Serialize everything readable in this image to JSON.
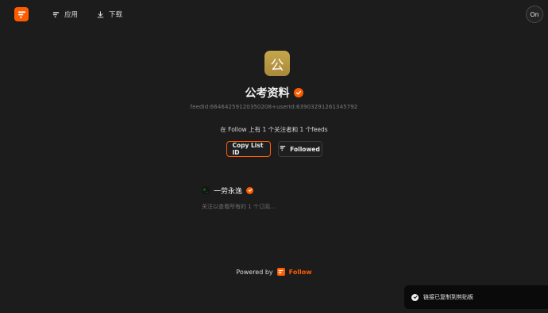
{
  "header": {
    "nav": [
      {
        "label": "应用",
        "icon": "follow-icon"
      },
      {
        "label": "下载",
        "icon": "download-icon"
      }
    ],
    "toggle_label": "On"
  },
  "profile": {
    "avatar_char": "公",
    "title": "公考资料",
    "ids": "feedId:66464259120350208+userId:63903291261345792",
    "summary": "在 Follow 上有 1 个关注者和 1 个feeds"
  },
  "actions": {
    "copy_label": "Copy List ID",
    "followed_label": "Followed"
  },
  "feed_list": {
    "items": [
      {
        "name": "一劳永逸",
        "icon_text": ">_"
      }
    ],
    "hint": "关注以查看所有的 1 个订阅..."
  },
  "footer": {
    "powered_by": "Powered by",
    "brand": "Follow"
  },
  "toast": {
    "message": "链接已复制到剪贴板"
  },
  "colors": {
    "accent": "#ff5c00",
    "background": "#1c1c1c"
  }
}
